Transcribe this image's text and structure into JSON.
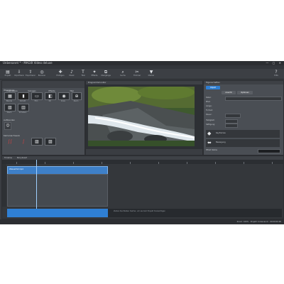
{
  "window": {
    "title": "Unbenannt * - MAGIX Video deluxe",
    "controls": "— ▢ ✕"
  },
  "menu": [
    "Datei",
    "Bearbeiten",
    "Ansicht",
    "Effekte",
    "Wiedergabe",
    "Extras",
    "Hilfe"
  ],
  "toolbar": [
    {
      "label": "Projekt",
      "icon": "▤"
    },
    {
      "label": "Importieren",
      "icon": "⇩"
    },
    {
      "label": "Exportieren",
      "icon": "⇧"
    },
    {
      "label": "Brennen",
      "icon": "◎"
    },
    {
      "label": "Einfügen",
      "icon": "✚"
    },
    {
      "label": "Musik",
      "icon": "♪"
    },
    {
      "label": "Titel",
      "icon": "T"
    },
    {
      "label": "Effekte",
      "icon": "✦"
    },
    {
      "label": "Übergänge",
      "icon": "⧉"
    },
    {
      "label": "Suche",
      "icon": "⌕"
    },
    {
      "label": "Trimmer",
      "icon": "✂"
    },
    {
      "label": "Marker",
      "icon": "▼"
    },
    {
      "label": "Hilfe",
      "icon": "?"
    }
  ],
  "left_panel": {
    "tabs": [
      "Importieren",
      "Vorlagen",
      "Effekte",
      "Titel"
    ],
    "section_1": "Übergänge",
    "thumbs": [
      "Blende",
      "Schnitt",
      "Film",
      "3D",
      "Kreis",
      "Zoom",
      "Wisch",
      "Schieben"
    ],
    "section_2": "Aufblenden",
    "section_3": "Kameraschwenk"
  },
  "preview": {
    "header": "Programmmonitor",
    "controls": [
      "⏮",
      "◀",
      "▶",
      "■",
      "▶▶",
      "⏭"
    ]
  },
  "right_panel": {
    "header": "Eigenschaften",
    "buttons": [
      "Objekt",
      "Ansicht",
      "Optionen"
    ],
    "props": [
      "Datei:",
      "Pfad:",
      "Länge:",
      "Format:",
      "Dauer:",
      "Helligkeit:",
      "Sättigung:"
    ],
    "cards": [
      "Keyframes",
      "Bewegung"
    ],
    "footer": "Effekt Stärke"
  },
  "timeline": {
    "tabs": [
      "Timeline",
      "Storyboard"
    ],
    "clip_label": "Wasserfall.mp4",
    "hint": "Ziehen Sie Medien hierher, um sie dem Projekt hinzuzufügen"
  },
  "status": {
    "text": "Zoom: 100% · Projekt: Unbenannt · 00:00:00:00"
  }
}
